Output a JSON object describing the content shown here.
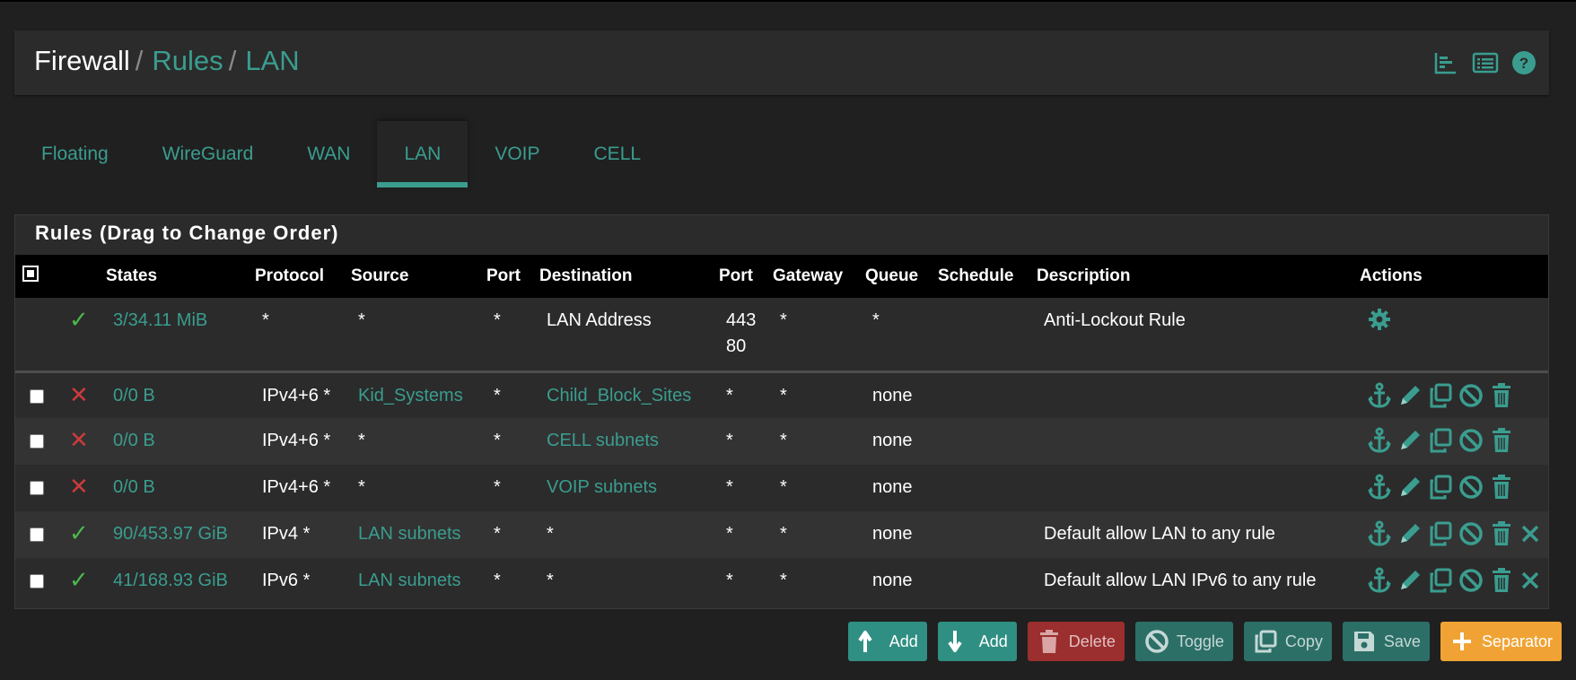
{
  "breadcrumb": {
    "root": "Firewall",
    "sep": "/",
    "level1": "Rules",
    "level2": "LAN"
  },
  "header_icons": [
    "chart-icon",
    "list-icon",
    "help-icon"
  ],
  "tabs": [
    {
      "label": "Floating",
      "active": false
    },
    {
      "label": "WireGuard",
      "active": false
    },
    {
      "label": "WAN",
      "active": false
    },
    {
      "label": "LAN",
      "active": true
    },
    {
      "label": "VOIP",
      "active": false
    },
    {
      "label": "CELL",
      "active": false
    }
  ],
  "panel_title": "Rules (Drag to Change Order)",
  "columns": [
    "States",
    "Protocol",
    "Source",
    "Port",
    "Destination",
    "Port",
    "Gateway",
    "Queue",
    "Schedule",
    "Description",
    "Actions"
  ],
  "rules": [
    {
      "status": "pass",
      "states": "3/34.11 MiB",
      "protocol": "*",
      "source": "*",
      "sport": "*",
      "destination": "LAN Address",
      "dport_a": "443",
      "dport_b": "80",
      "gateway": "*",
      "queue": "*",
      "schedule": "",
      "description": "Anti-Lockout Rule"
    },
    {
      "status": "block",
      "states": "0/0 B",
      "protocol": "IPv4+6 *",
      "source": "Kid_Systems",
      "sport": "*",
      "destination": "Child_Block_Sites",
      "dport": "*",
      "gateway": "*",
      "queue": "none",
      "schedule": "",
      "description": ""
    },
    {
      "status": "block",
      "states": "0/0 B",
      "protocol": "IPv4+6 *",
      "source": "*",
      "sport": "*",
      "destination": "CELL subnets",
      "dport": "*",
      "gateway": "*",
      "queue": "none",
      "schedule": "",
      "description": ""
    },
    {
      "status": "block",
      "states": "0/0 B",
      "protocol": "IPv4+6 *",
      "source": "*",
      "sport": "*",
      "destination": "VOIP subnets",
      "dport": "*",
      "gateway": "*",
      "queue": "none",
      "schedule": "",
      "description": ""
    },
    {
      "status": "pass",
      "states": "90/453.97 GiB",
      "protocol": "IPv4 *",
      "source": "LAN subnets",
      "sport": "*",
      "destination": "*",
      "dport": "*",
      "gateway": "*",
      "queue": "none",
      "schedule": "",
      "description": "Default allow LAN to any rule"
    },
    {
      "status": "pass",
      "states": "41/168.93 GiB",
      "protocol": "IPv6 *",
      "source": "LAN subnets",
      "sport": "*",
      "destination": "*",
      "dport": "*",
      "gateway": "*",
      "queue": "none",
      "schedule": "",
      "description": "Default allow LAN IPv6 to any rule"
    }
  ],
  "status_glyphs": {
    "pass": "✓",
    "block": "✕"
  },
  "buttons": {
    "add_top": "Add",
    "add_bottom": "Add",
    "delete": "Delete",
    "toggle": "Toggle",
    "copy": "Copy",
    "save": "Save",
    "separator": "Separator"
  },
  "colors": {
    "accent": "#3a9d8f",
    "pass": "#4cb84c",
    "block": "#cc3b3b",
    "separator": "#f0a334",
    "danger": "#9b2e2e"
  }
}
